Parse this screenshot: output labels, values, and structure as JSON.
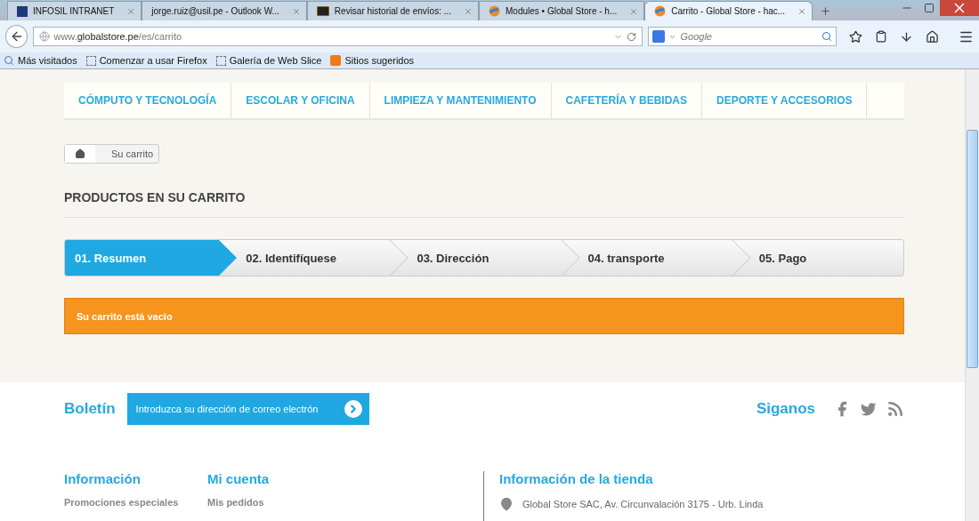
{
  "browser": {
    "tabs": [
      {
        "title": "INFOSIL INTRANET",
        "selected": false
      },
      {
        "title": "jorge.ruiz@usil.pe - Outlook W...",
        "selected": false
      },
      {
        "title": "Revisar historial de envíos: ...",
        "selected": false
      },
      {
        "title": "Modules • Global Store - h...",
        "selected": false
      },
      {
        "title": "Carrito - Global Store - hac...",
        "selected": true
      }
    ],
    "url_host": "www.",
    "url_domain": "globalstore.pe",
    "url_path": "/es/carrito",
    "search_placeholder": "Google",
    "bookmarks": [
      "Más visitados",
      "Comenzar a usar Firefox",
      "Galería de Web Slice",
      "Sitios sugeridos"
    ]
  },
  "nav": [
    "CÓMPUTO Y TECNOLOGÍA",
    "ESCOLAR Y OFICINA",
    "LIMPIEZA Y MANTENIMIENTO",
    "CAFETERÍA Y BEBIDAS",
    "DEPORTE Y ACCESORIOS"
  ],
  "breadcrumb": "Su carrito",
  "title": "PRODUCTOS EN SU CARRITO",
  "steps": [
    {
      "label": "01. Resumen",
      "selected": true
    },
    {
      "label": "02. Identifíquese",
      "selected": false
    },
    {
      "label": "03. Dirección",
      "selected": false
    },
    {
      "label": "04. transporte",
      "selected": false
    },
    {
      "label": "05. Pago",
      "selected": false
    }
  ],
  "alert": "Su carrito está vacio",
  "footer": {
    "newsletter_title": "Boletín",
    "newsletter_placeholder": "Introduzca su dirección de correo electrón",
    "follow": "Siganos",
    "columns": [
      {
        "title": "Información",
        "links": [
          "Promociones especiales"
        ]
      },
      {
        "title": "Mi cuenta",
        "links": [
          "Mis pedidos"
        ]
      }
    ],
    "store_title": "Información de la tienda",
    "address": "Global Store SAC, Av. Circunvalación 3175 - Urb. Linda"
  }
}
